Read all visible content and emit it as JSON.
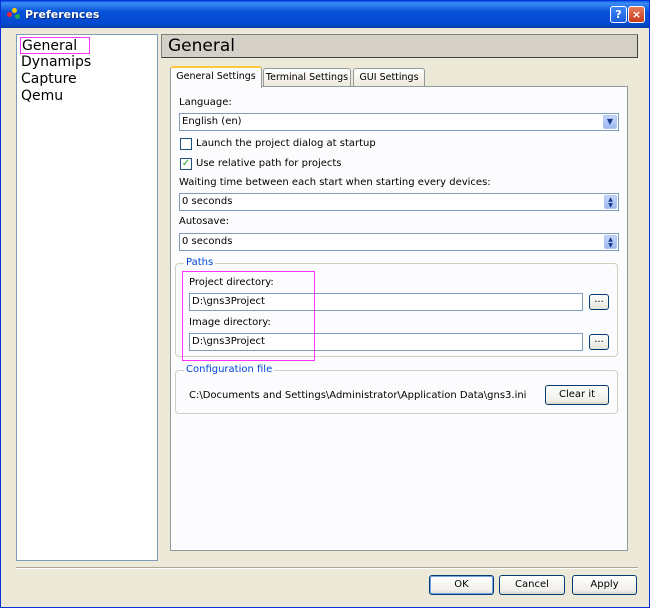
{
  "window": {
    "title": "Preferences"
  },
  "nav": {
    "items": [
      "General",
      "Dynamips",
      "Capture",
      "Qemu"
    ]
  },
  "page_title": "General",
  "tabs": [
    "General Settings",
    "Terminal Settings",
    "GUI Settings"
  ],
  "general": {
    "language_label": "Language:",
    "language_value": "English (en)",
    "launch_dialog_label": "Launch the project dialog at startup",
    "launch_dialog_checked": false,
    "relative_path_label": "Use relative path for projects",
    "relative_path_checked": true,
    "wait_label": "Waiting time between each start when starting every devices:",
    "wait_value": "0 seconds",
    "autosave_label": "Autosave:",
    "autosave_value": "0 seconds"
  },
  "paths": {
    "title": "Paths",
    "project_label": "Project directory:",
    "project_value": "D:\\gns3Project",
    "image_label": "Image directory:",
    "image_value": "D:\\gns3Project",
    "browse_label": "..."
  },
  "config": {
    "title": "Configuration file",
    "path": "C:\\Documents and Settings\\Administrator\\Application Data\\gns3.ini",
    "clear_label": "Clear it"
  },
  "buttons": {
    "ok": "OK",
    "cancel": "Cancel",
    "apply": "Apply"
  },
  "icons": {
    "help": "?",
    "close": "×",
    "check": "✓",
    "dropdown": "▼",
    "spin_up": "▲",
    "spin_down": "▼"
  },
  "colors": {
    "titlebar": "#0551d6",
    "highlight": "#ff33ff",
    "group_title": "#0046d5"
  }
}
